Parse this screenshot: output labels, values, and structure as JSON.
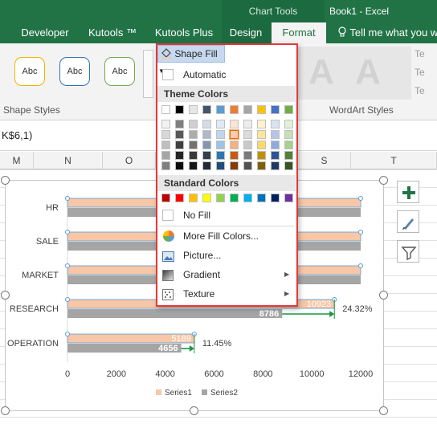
{
  "titlebar": {
    "context_title": "Chart Tools",
    "book_title": "Book1 - Excel"
  },
  "tabs": [
    "Developer",
    "Kutools ™",
    "Kutools Plus",
    "Design",
    "Format"
  ],
  "tell_me": "Tell me what you w",
  "ribbon": {
    "shape_style_samples": [
      "Abc",
      "Abc",
      "Abc"
    ],
    "shape_styles_label": "Shape Styles",
    "wordart_label": "WordArt Styles",
    "wordart_sample": "A",
    "wordart_rows": [
      "Te",
      "Te",
      "Te"
    ]
  },
  "formula_text": "K$6,1)",
  "columns": [
    "M",
    "N",
    "O",
    "S",
    "T"
  ],
  "menu": {
    "shape_fill": "Shape Fill",
    "automatic": "Automatic",
    "theme_colors": "Theme Colors",
    "standard_colors": "Standard Colors",
    "no_fill": "No Fill",
    "more_fill": "More Fill Colors...",
    "picture": "Picture...",
    "gradient": "Gradient",
    "texture": "Texture",
    "theme_top": [
      "#ffffff",
      "#000000",
      "#e7e6e6",
      "#44546a",
      "#5b9bd5",
      "#ed7d31",
      "#a5a5a5",
      "#ffc000",
      "#4472c4",
      "#70ad47"
    ],
    "theme_shades": [
      [
        "#f2f2f2",
        "#7f7f7f",
        "#d0cece",
        "#d6dce4",
        "#deebf6",
        "#fbe5d5",
        "#ededed",
        "#fff2cc",
        "#dae3f3",
        "#e2efd9"
      ],
      [
        "#d8d8d8",
        "#595959",
        "#aeabab",
        "#adb9ca",
        "#bdd7ee",
        "#f7cbac",
        "#dbdbdb",
        "#fee599",
        "#b4c6e7",
        "#c5e0b3"
      ],
      [
        "#bfbfbf",
        "#3f3f3f",
        "#757070",
        "#8496b0",
        "#9dc3e6",
        "#f4b183",
        "#c9c9c9",
        "#ffd965",
        "#8faadc",
        "#a8d08d"
      ],
      [
        "#a5a5a5",
        "#262626",
        "#3a3838",
        "#323f4f",
        "#2e75b5",
        "#c55a11",
        "#7b7b7b",
        "#bf9000",
        "#2f5496",
        "#538135"
      ],
      [
        "#7f7f7f",
        "#0c0c0c",
        "#171616",
        "#222a35",
        "#1e4e79",
        "#833c0b",
        "#525252",
        "#7f6000",
        "#203864",
        "#375623"
      ]
    ],
    "standard": [
      "#c00000",
      "#ff0000",
      "#ffc000",
      "#ffff00",
      "#92d050",
      "#00b050",
      "#00b0f0",
      "#0070c0",
      "#002060",
      "#7030a0"
    ]
  },
  "chart_data": {
    "type": "bar",
    "categories": [
      "HR",
      "SALE",
      "MARKET",
      "RESEARCH",
      "OPERATION"
    ],
    "series": [
      {
        "name": "Series1",
        "values": [
          null,
          null,
          null,
          10923,
          5189
        ],
        "color": "#f7c7a7"
      },
      {
        "name": "Series2",
        "values": [
          null,
          null,
          null,
          8786,
          4656
        ],
        "color": "#a5a5a5"
      }
    ],
    "x_ticks": [
      "0",
      "2000",
      "4000",
      "6000",
      "8000",
      "10000",
      "12000"
    ],
    "xlim": [
      0,
      12000
    ],
    "annotations": [
      {
        "category": "RESEARCH",
        "text": "24.32%"
      },
      {
        "category": "OPERATION",
        "text": "11.45%"
      }
    ],
    "legend": [
      "Series1",
      "Series2"
    ],
    "legend_position": "bottom"
  },
  "colors": {
    "excel_green": "#217346",
    "highlight_red": "#e03a3a",
    "arrow_green": "#1a9641",
    "selection_blue": "#4472c4"
  },
  "icons": [
    "plus-icon",
    "brush-icon",
    "filter-icon",
    "paint-bucket-icon",
    "color-wheel-icon",
    "picture-icon",
    "gradient-icon",
    "texture-icon",
    "lightbulb-icon"
  ]
}
